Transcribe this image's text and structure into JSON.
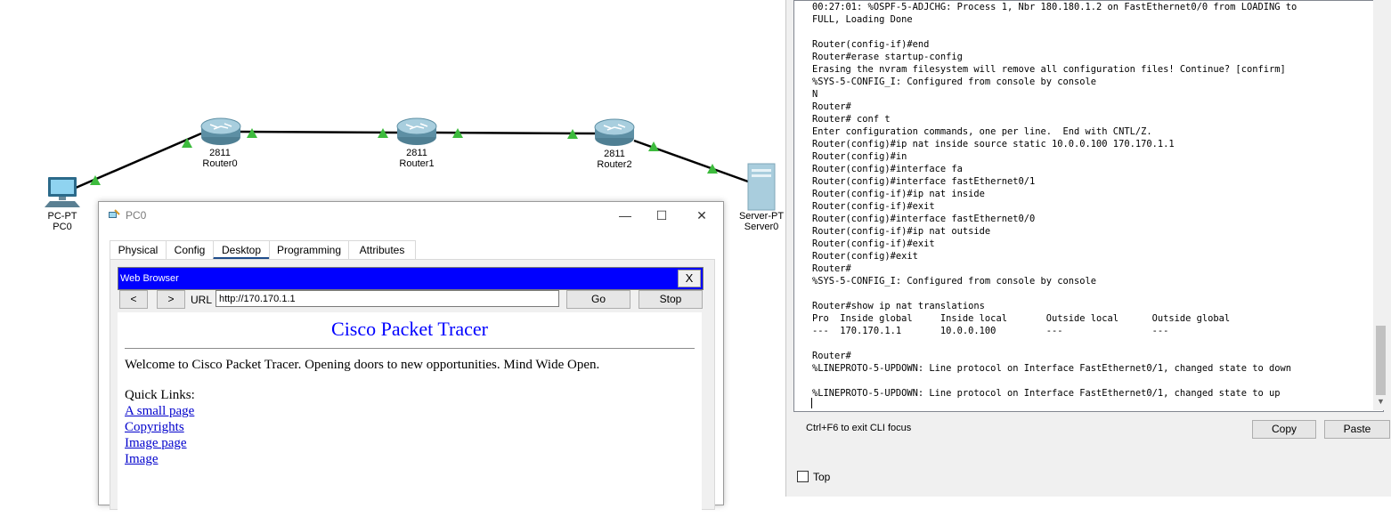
{
  "topology": {
    "devices": [
      {
        "id": "pc0",
        "model": "PC-PT",
        "name": "PC0"
      },
      {
        "id": "router0",
        "model": "2811",
        "name": "Router0"
      },
      {
        "id": "router1",
        "model": "2811",
        "name": "Router1"
      },
      {
        "id": "router2",
        "model": "2811",
        "name": "Router2"
      },
      {
        "id": "server0",
        "model": "Server-PT",
        "name": "Server0"
      }
    ],
    "link_color": "#000000",
    "link_status_color": "#3dbb3d"
  },
  "pc_window": {
    "title": "PC0",
    "controls": {
      "minimize": "—",
      "maximize": "☐",
      "close": "✕"
    },
    "tabs": [
      {
        "label": "Physical"
      },
      {
        "label": "Config"
      },
      {
        "label": "Desktop"
      },
      {
        "label": "Programming"
      },
      {
        "label": "Attributes"
      }
    ],
    "browser": {
      "title": "Web Browser",
      "close": "X",
      "back": "<",
      "forward": ">",
      "url_label": "URL",
      "url": "http://170.170.1.1",
      "go": "Go",
      "stop": "Stop",
      "page": {
        "heading": "Cisco Packet Tracer",
        "welcome": "Welcome to Cisco Packet Tracer. Opening doors to new opportunities. Mind Wide Open.",
        "quick_links_label": "Quick Links:",
        "links": [
          "A small page",
          "Copyrights",
          "Image page",
          "Image"
        ]
      }
    }
  },
  "cli": {
    "output": "00:27:01: %OSPF-5-ADJCHG: Process 1, Nbr 180.180.1.2 on FastEthernet0/0 from LOADING to\nFULL, Loading Done\n\nRouter(config-if)#end\nRouter#erase startup-config\nErasing the nvram filesystem will remove all configuration files! Continue? [confirm]\n%SYS-5-CONFIG_I: Configured from console by console\nN\nRouter#\nRouter# conf t\nEnter configuration commands, one per line.  End with CNTL/Z.\nRouter(config)#ip nat inside source static 10.0.0.100 170.170.1.1\nRouter(config)#in\nRouter(config)#interface fa\nRouter(config)#interface fastEthernet0/1\nRouter(config-if)#ip nat inside\nRouter(config-if)#exit\nRouter(config)#interface fastEthernet0/0\nRouter(config-if)#ip nat outside\nRouter(config-if)#exit\nRouter(config)#exit\nRouter#\n%SYS-5-CONFIG_I: Configured from console by console\n\nRouter#show ip nat translations\nPro  Inside global     Inside local       Outside local      Outside global\n---  170.170.1.1       10.0.0.100         ---                ---\n\nRouter#\n%LINEPROTO-5-UPDOWN: Line protocol on Interface FastEthernet0/1, changed state to down\n\n%LINEPROTO-5-UPDOWN: Line protocol on Interface FastEthernet0/1, changed state to up\n",
    "hint": "Ctrl+F6 to exit CLI focus",
    "copy": "Copy",
    "paste": "Paste",
    "top_label": "Top"
  }
}
